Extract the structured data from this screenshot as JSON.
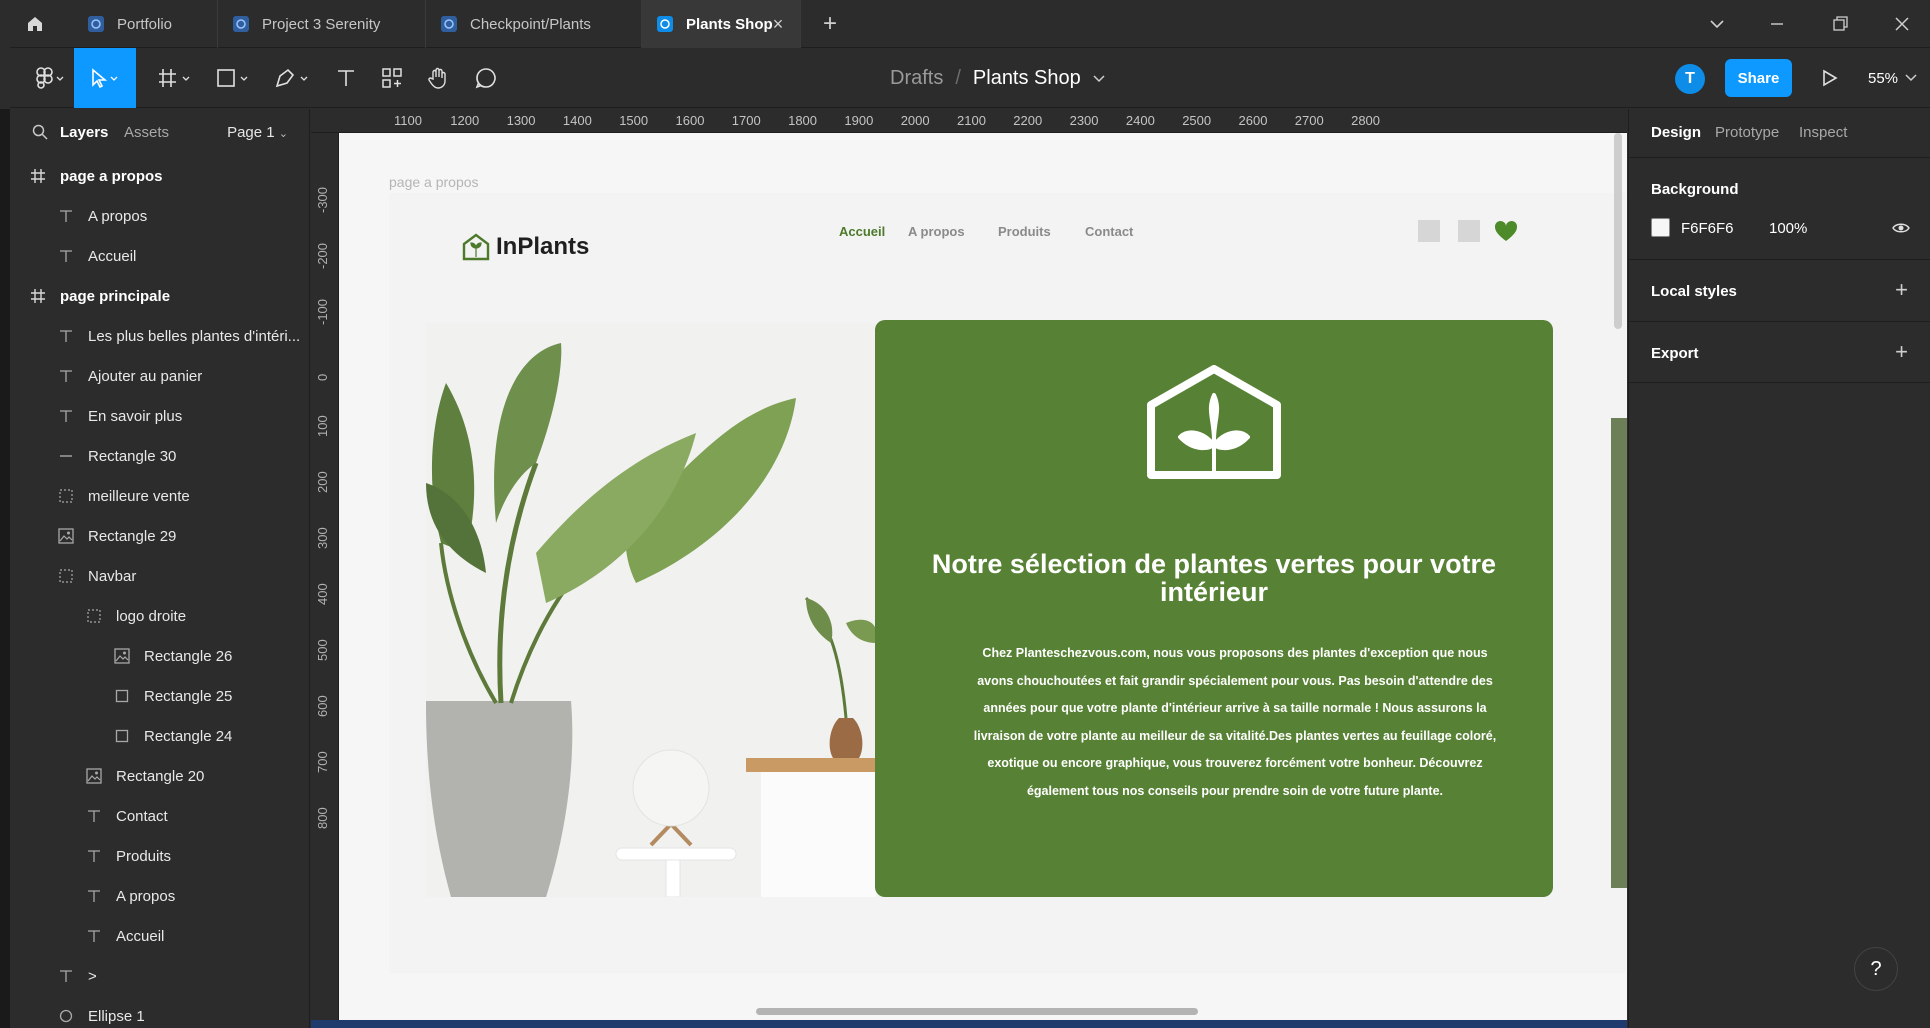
{
  "tabs": [
    {
      "label": "Portfolio"
    },
    {
      "label": "Project 3 Serenity"
    },
    {
      "label": "Checkpoint/Plants"
    },
    {
      "label": "Plants Shop"
    }
  ],
  "tab_close": "×",
  "new_tab": "+",
  "toolbar": {
    "breadcrumb_root": "Drafts",
    "breadcrumb_sep": "/",
    "file_name": "Plants Shop",
    "avatar_initial": "T",
    "share_label": "Share",
    "zoom": "55%"
  },
  "left_panel": {
    "tabs": {
      "layers": "Layers",
      "assets": "Assets"
    },
    "page": "Page 1",
    "layers": [
      {
        "label": "page a propos",
        "icon": "frame-icon"
      },
      {
        "label": "A propos",
        "icon": "text-icon"
      },
      {
        "label": "Accueil",
        "icon": "text-icon"
      },
      {
        "label": "page principale",
        "icon": "frame-icon"
      },
      {
        "label": "Les plus belles plantes d'intéri...",
        "icon": "text-icon"
      },
      {
        "label": "Ajouter au panier",
        "icon": "text-icon"
      },
      {
        "label": "En savoir plus",
        "icon": "text-icon"
      },
      {
        "label": "Rectangle 30",
        "icon": "line-icon"
      },
      {
        "label": "meilleure vente",
        "icon": "group-icon"
      },
      {
        "label": "Rectangle 29",
        "icon": "image-icon"
      },
      {
        "label": "Navbar",
        "icon": "group-icon"
      },
      {
        "label": "logo droite",
        "icon": "group-icon"
      },
      {
        "label": "Rectangle 26",
        "icon": "image-icon"
      },
      {
        "label": "Rectangle 25",
        "icon": "rectangle-icon"
      },
      {
        "label": "Rectangle 24",
        "icon": "rectangle-icon"
      },
      {
        "label": "Rectangle 20",
        "icon": "image-icon"
      },
      {
        "label": "Contact",
        "icon": "text-icon"
      },
      {
        "label": "Produits",
        "icon": "text-icon"
      },
      {
        "label": "A propos",
        "icon": "text-icon"
      },
      {
        "label": "Accueil",
        "icon": "text-icon"
      },
      {
        "label": ">",
        "icon": "text-icon"
      },
      {
        "label": "Ellipse 1",
        "icon": "ellipse-icon"
      }
    ]
  },
  "rulers": {
    "top": [
      "1100",
      "1200",
      "1300",
      "1400",
      "1500",
      "1600",
      "1700",
      "1800",
      "1900",
      "2000",
      "2100",
      "2200",
      "2300",
      "2400",
      "2500",
      "2600",
      "2700",
      "2800"
    ],
    "left": [
      "-300",
      "-200",
      "-100",
      "0",
      "100",
      "200",
      "300",
      "400",
      "500",
      "600",
      "700",
      "800"
    ]
  },
  "canvas": {
    "frame_label": "page a propos",
    "site": {
      "brand": "InPlants",
      "nav": [
        "Accueil",
        "A propos",
        "Produits",
        "Contact"
      ],
      "hero_title": "Notre sélection de plantes vertes pour votre intérieur",
      "hero_text": "Chez Planteschezvous.com, nous vous proposons des plantes d'exception que nous avons chouchoutées et fait grandir spécialement pour vous. Pas besoin d'attendre des années pour que votre plante d'intérieur arrive à sa taille normale ! Nous assurons la livraison de votre plante au meilleur de sa vitalité.Des plantes vertes au feuillage coloré, exotique ou encore graphique, vous trouverez forcément votre bonheur. Découvrez également tous nos conseils pour prendre soin de votre future plante.",
      "accent_color": "#578134",
      "nav_active_color": "#4d7a2a"
    }
  },
  "right_panel": {
    "tabs": {
      "design": "Design",
      "prototype": "Prototype",
      "inspect": "Inspect"
    },
    "background_label": "Background",
    "background_hex": "F6F6F6",
    "background_opacity": "100%",
    "local_styles": "Local styles",
    "export": "Export"
  },
  "help": "?"
}
